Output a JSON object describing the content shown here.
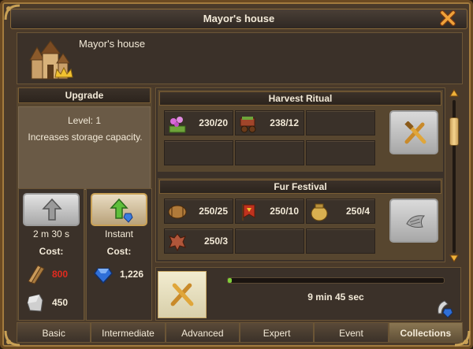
{
  "window": {
    "title": "Mayor's house"
  },
  "building": {
    "name": "Mayor's house"
  },
  "upgrade": {
    "title": "Upgrade",
    "level": "Level: 1",
    "description": "Increases storage capacity.",
    "normal": {
      "time": "2 m 30 s",
      "cost_label": "Cost:",
      "costs": [
        "800",
        "450"
      ]
    },
    "instant": {
      "label": "Instant",
      "cost_label": "Cost:",
      "cost": "1,226"
    }
  },
  "collections": [
    {
      "title": "Harvest Ritual",
      "slots": [
        {
          "icon": "flowers-icon",
          "value": "230/20"
        },
        {
          "icon": "cart-icon",
          "value": "238/12"
        },
        {
          "icon": "",
          "value": ""
        },
        {
          "icon": "",
          "value": ""
        },
        {
          "icon": "",
          "value": ""
        },
        {
          "icon": "",
          "value": ""
        }
      ]
    },
    {
      "title": "Fur Festival",
      "slots": [
        {
          "icon": "barrel-icon",
          "value": "250/25"
        },
        {
          "icon": "banner-icon",
          "value": "250/10"
        },
        {
          "icon": "honey-pot-icon",
          "value": "250/4"
        },
        {
          "icon": "pelt-icon",
          "value": "250/3"
        },
        {
          "icon": "",
          "value": ""
        },
        {
          "icon": "",
          "value": ""
        }
      ]
    }
  ],
  "queue": {
    "time_left": "9 min 45 sec",
    "progress": 0.02
  },
  "tabs": [
    "Basic",
    "Intermediate",
    "Advanced",
    "Expert",
    "Event",
    "Collections"
  ],
  "active_tab": "Collections",
  "colors": {
    "cost_insufficient": "#e22b1f",
    "progress": "#7fcf3a"
  }
}
